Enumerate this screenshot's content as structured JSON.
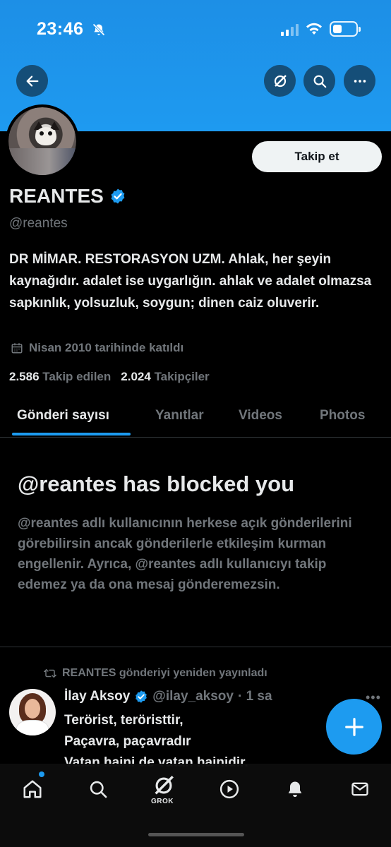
{
  "status_bar": {
    "time": "23:46"
  },
  "profile": {
    "name": "REANTES",
    "handle": "@reantes",
    "bio": "DR MİMAR. RESTORASYON UZM. Ahlak, her şeyin kaynağıdır. adalet ise uygarlığın. ahlak ve adalet olmazsa sapkınlık, yolsuzluk, soygun; dinen caiz oluverir.",
    "joined": "Nisan 2010 tarihinde katıldı",
    "following_count": "2.586",
    "following_label": "Takip edilen",
    "followers_count": "2.024",
    "followers_label": "Takipçiler",
    "follow_button": "Takip et"
  },
  "tabs": [
    {
      "label": "Gönderi sayısı",
      "active": true
    },
    {
      "label": "Yanıtlar",
      "active": false
    },
    {
      "label": "Videos",
      "active": false
    },
    {
      "label": "Photos",
      "active": false
    }
  ],
  "blocked": {
    "title": "@reantes has blocked you",
    "message": "@reantes adlı kullanıcının herkese açık gönderilerini görebilirsin ancak gönderilerle etkileşim kurman engellenir. Ayrıca, @reantes adlı kullanıcıyı takip edemez ya da ona mesaj gönderemezsin."
  },
  "post": {
    "repost_label": "REANTES gönderiyi yeniden yayınladı",
    "author_name": "İlay Aksoy",
    "author_handle": "@ilay_aksoy",
    "time": "· 1 sa",
    "lines": [
      "Terörist, teröristtir,",
      "Paçavra, paçavradır",
      "Vatan haini de vatan hainidir."
    ]
  },
  "bottom_nav": {
    "grok_label": "GROK"
  },
  "colors": {
    "accent": "#1d9bf0",
    "banner": "#1e96ee",
    "background": "#000000",
    "muted": "#71767b"
  }
}
